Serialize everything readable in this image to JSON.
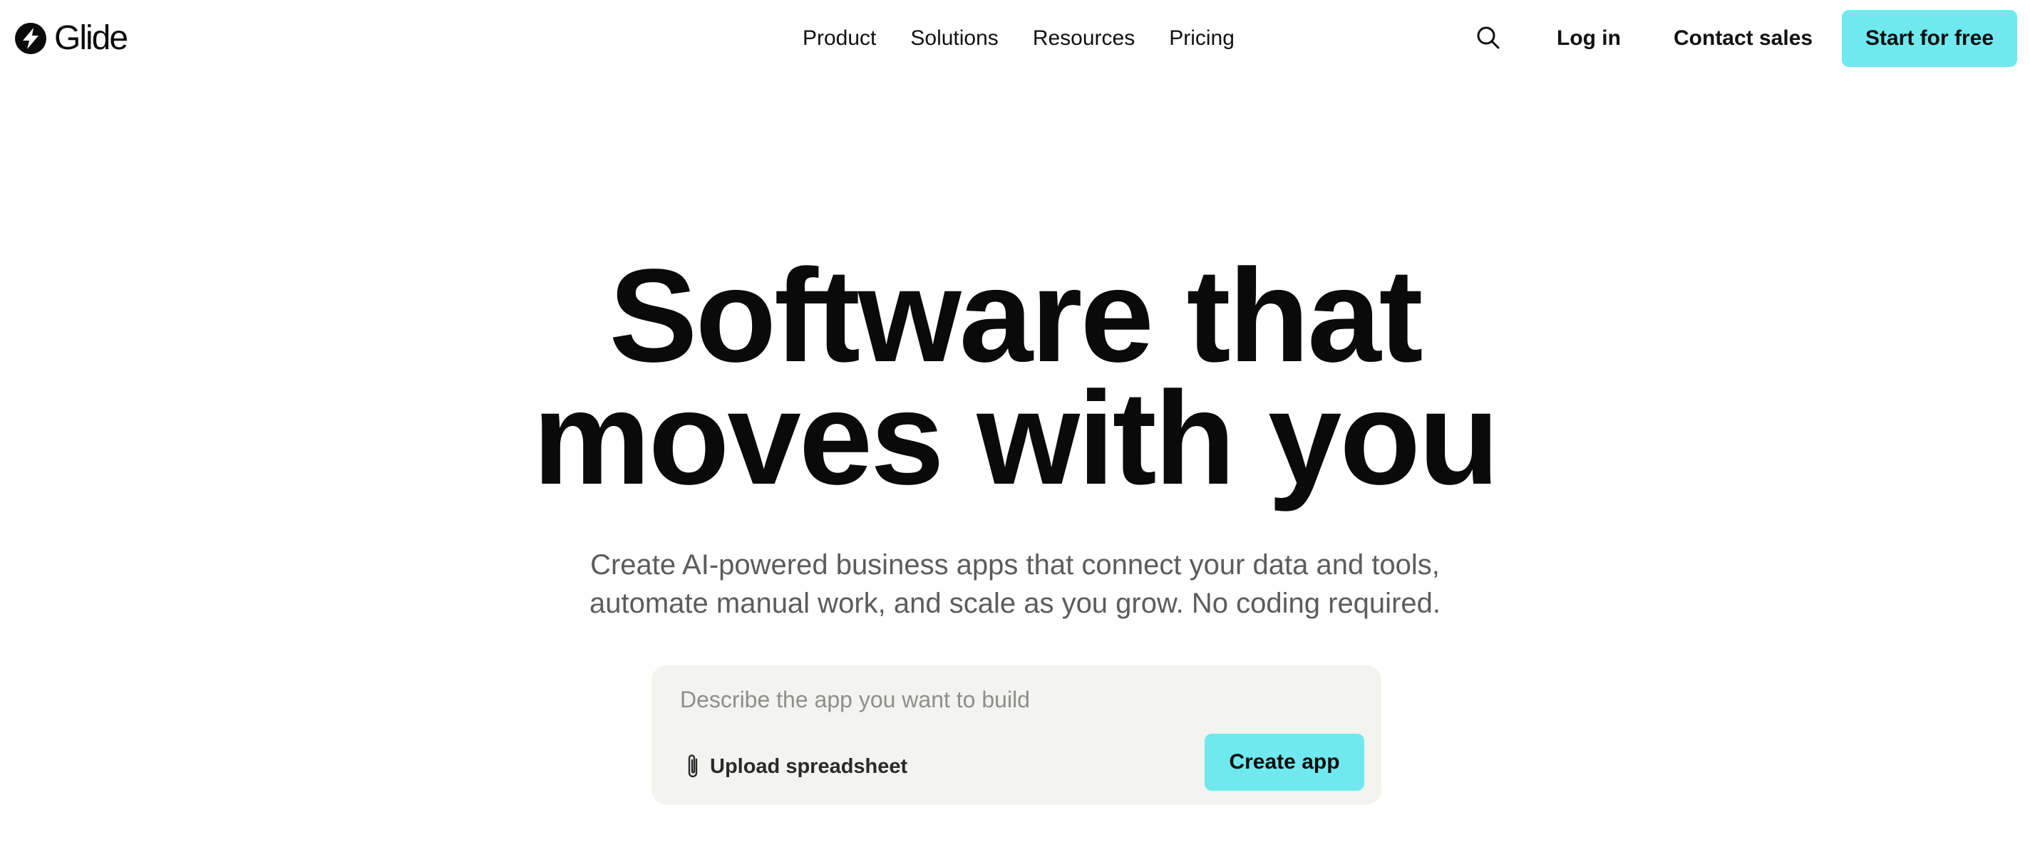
{
  "brand": {
    "name": "Glide",
    "logo_icon": "bolt-circle-icon"
  },
  "nav": {
    "items": [
      {
        "label": "Product"
      },
      {
        "label": "Solutions"
      },
      {
        "label": "Resources"
      },
      {
        "label": "Pricing"
      }
    ]
  },
  "header_actions": {
    "search_icon": "search-icon",
    "login_label": "Log in",
    "contact_label": "Contact sales",
    "start_label": "Start for free"
  },
  "hero": {
    "title_line1": "Software that",
    "title_line2": "moves with you",
    "subtitle_line1": "Create AI-powered business apps that connect your data and tools,",
    "subtitle_line2": "automate manual work, and scale as you grow. No coding required."
  },
  "prompt": {
    "placeholder": "Describe the app you want to build",
    "value": "",
    "upload_icon": "paperclip-icon",
    "upload_label": "Upload spreadsheet",
    "create_label": "Create app"
  },
  "colors": {
    "accent": "#6fe9ee",
    "text": "#0b0b0b",
    "muted_text": "#5c5c5c",
    "prompt_bg": "#f3f3ef"
  }
}
